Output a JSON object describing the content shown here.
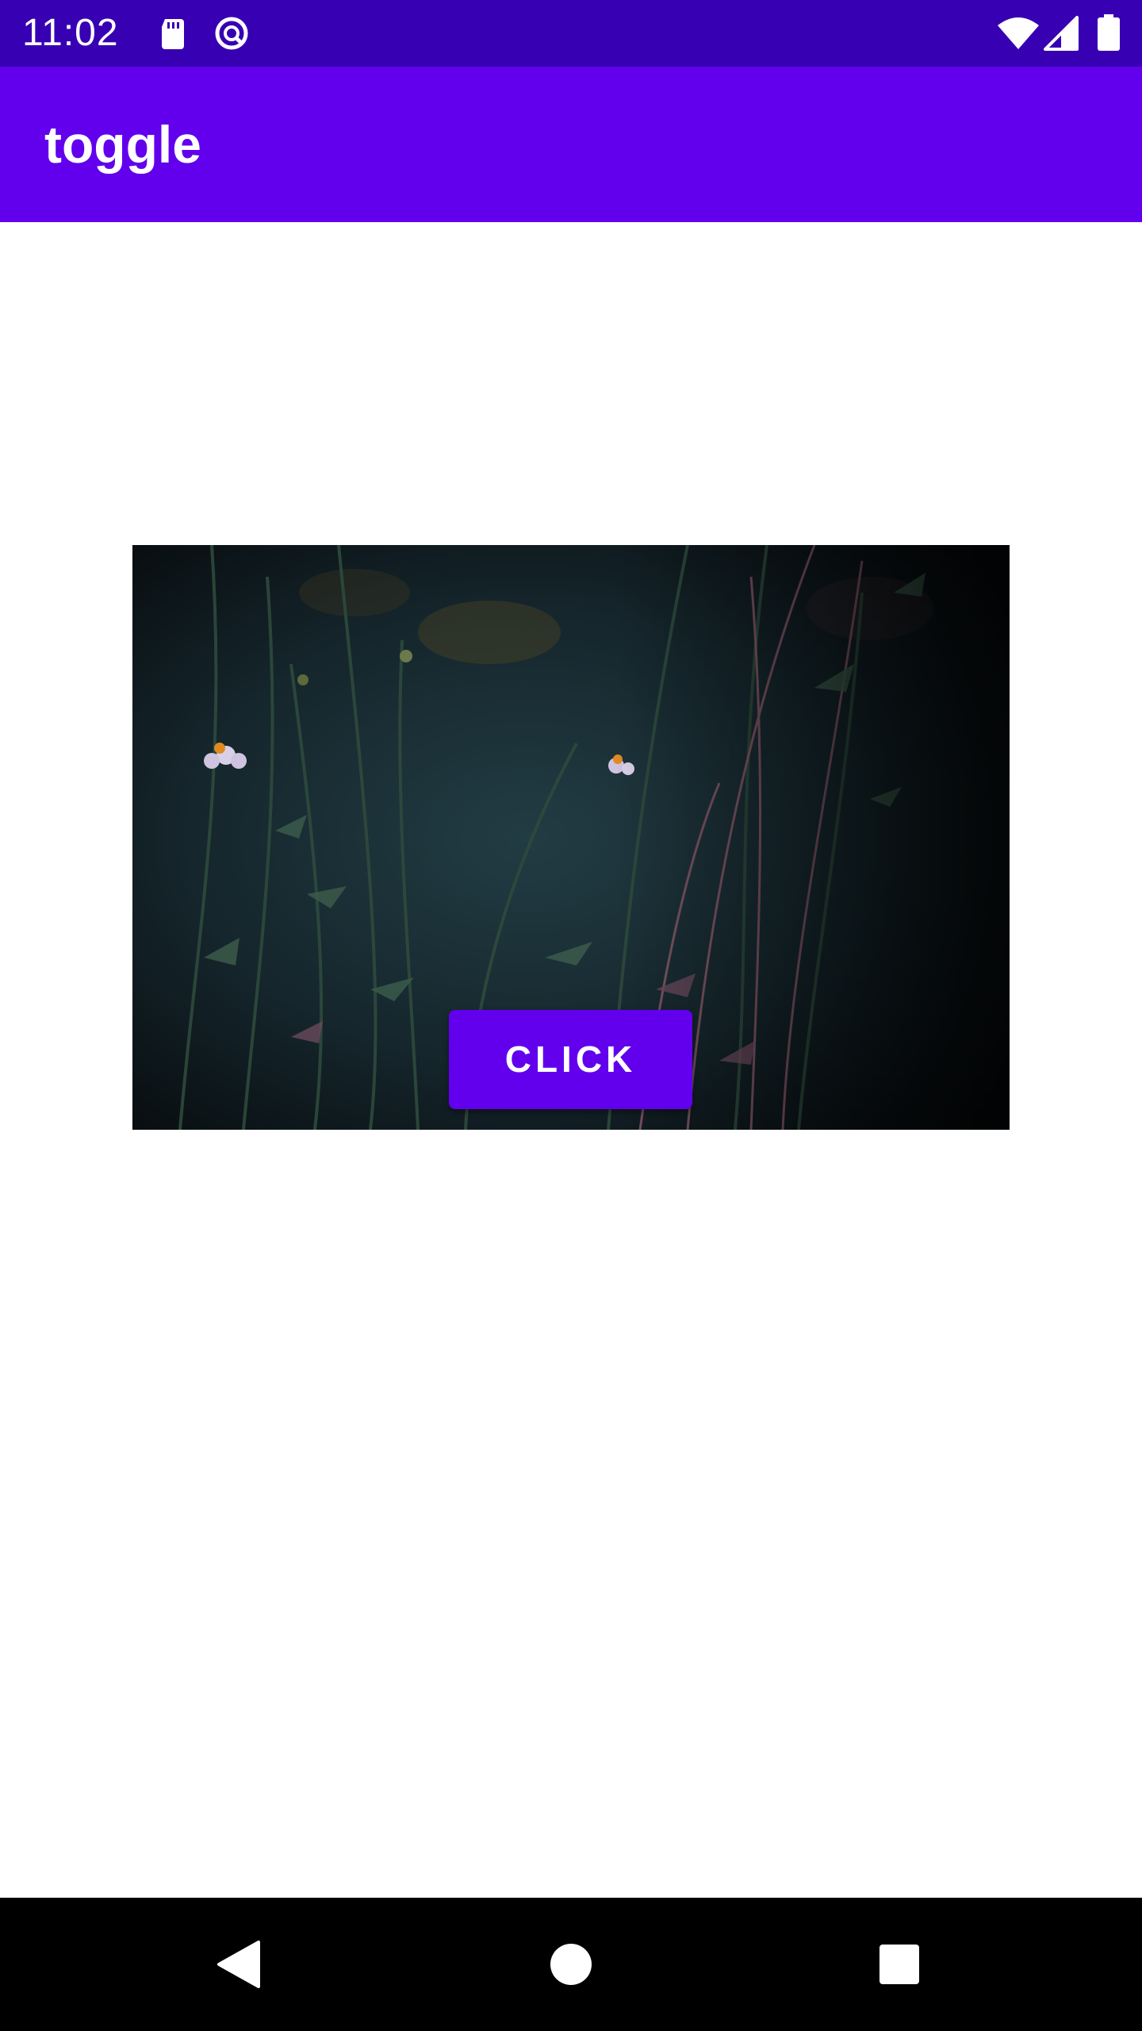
{
  "status_bar": {
    "time": "11:02",
    "icons": [
      "sd-card-icon",
      "data-saver-icon",
      "wifi-icon",
      "cell-signal-icon",
      "battery-icon"
    ],
    "background": "#3700b3"
  },
  "app_bar": {
    "title": "toggle",
    "background": "#6200ee"
  },
  "main": {
    "image": {
      "description_icon": "night-wildflowers-photo"
    },
    "button": {
      "label": "CLICK",
      "background": "#6200ee"
    }
  },
  "nav_bar": {
    "items": [
      "back-icon",
      "home-icon",
      "recents-icon"
    ],
    "background": "#000000"
  }
}
